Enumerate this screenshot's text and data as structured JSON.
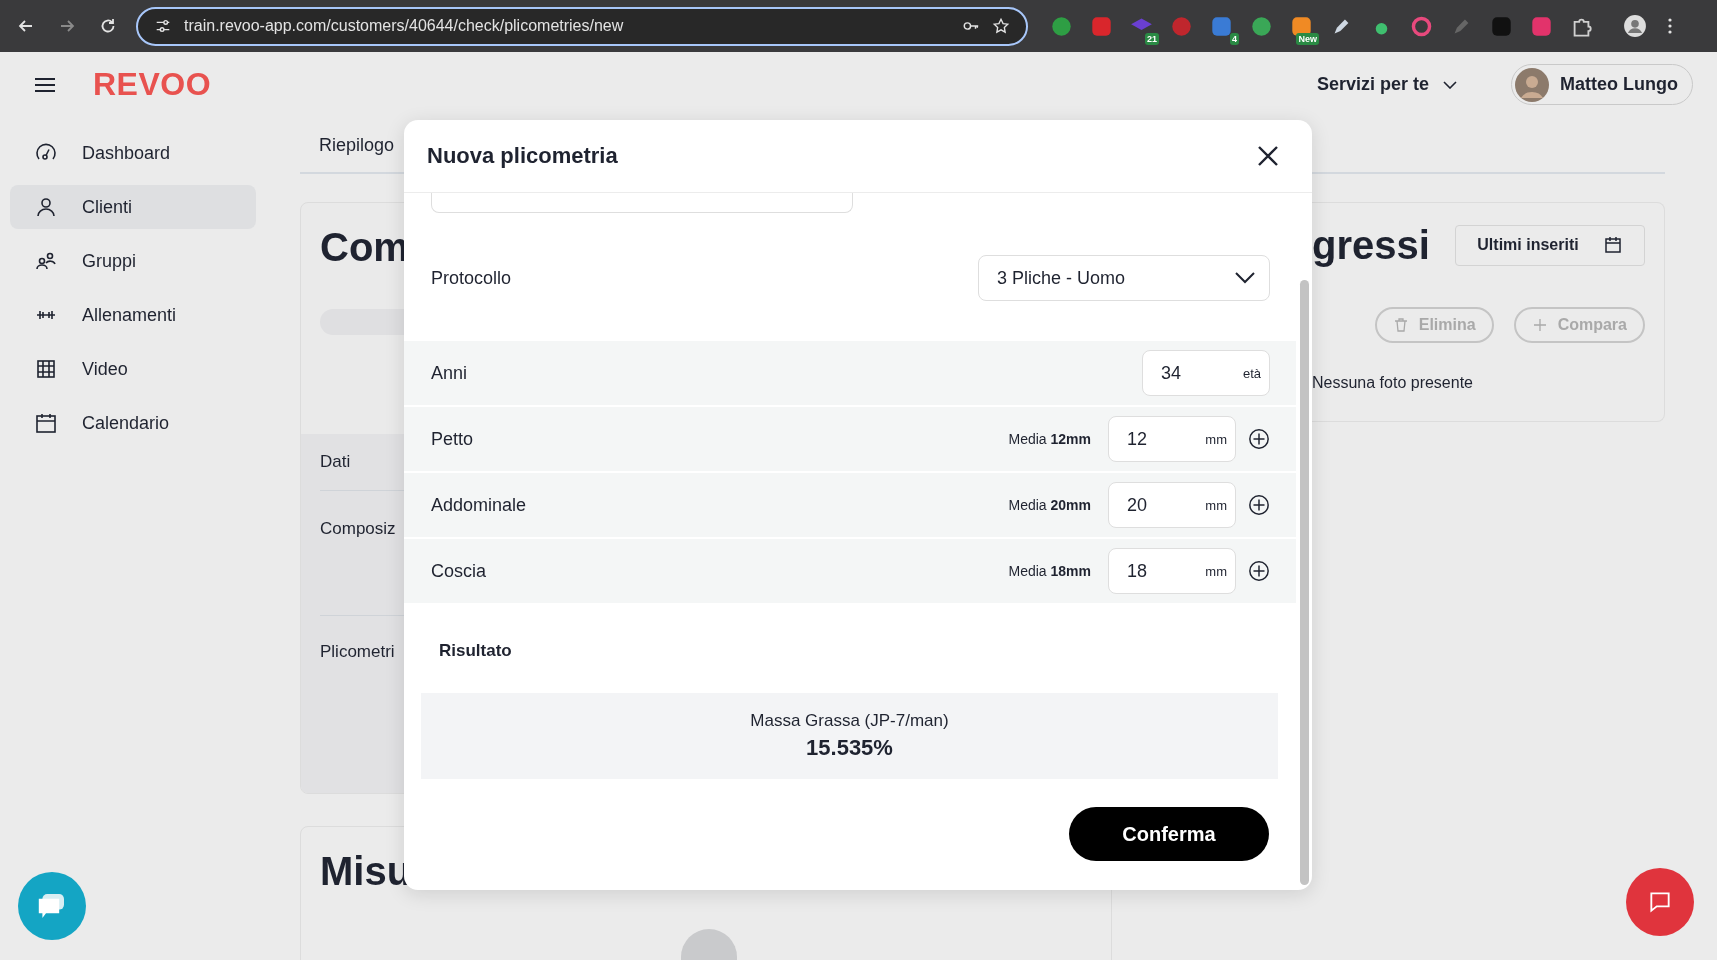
{
  "browser": {
    "url": "train.revoo-app.com/customers/40644/check/plicometries/new",
    "extension_badges": [
      "21",
      "4",
      "New"
    ]
  },
  "header": {
    "logo": "REVOO",
    "services_menu": "Servizi per te",
    "user_name": "Matteo Lungo"
  },
  "sidebar": {
    "items": [
      {
        "label": "Dashboard",
        "kind": "gauge",
        "selected": false
      },
      {
        "label": "Clienti",
        "kind": "person",
        "selected": true
      },
      {
        "label": "Gruppi",
        "kind": "group",
        "selected": false
      },
      {
        "label": "Allenamenti",
        "kind": "dumbbell",
        "selected": false
      },
      {
        "label": "Video",
        "kind": "film",
        "selected": false
      },
      {
        "label": "Calendario",
        "kind": "calendar",
        "selected": false
      }
    ]
  },
  "background": {
    "tab": "Riepilogo",
    "card_title": "Com",
    "section_header": "Dati",
    "rows": [
      "Composiz",
      "Plicometri"
    ],
    "second_card_title": "Misu",
    "progress_title": "gressi",
    "sort_button": "Ultimi inseriti",
    "delete_button": {
      "label": "Elimina",
      "disabled": true
    },
    "compare_button": {
      "label": "Compara",
      "disabled": true
    },
    "empty_photos": "Nessuna foto presente"
  },
  "modal": {
    "title": "Nuova plicometria",
    "protocol": {
      "label": "Protocollo",
      "value": "3 Pliche - Uomo"
    },
    "age": {
      "label": "Anni",
      "value": "34",
      "unit": "età"
    },
    "folds": [
      {
        "label": "Petto",
        "average": "Media **12mm**",
        "value": "12",
        "unit": "mm"
      },
      {
        "label": "Addominale",
        "average": "Media **20mm**",
        "value": "20",
        "unit": "mm"
      },
      {
        "label": "Coscia",
        "average": "Media **18mm**",
        "value": "18",
        "unit": "mm"
      }
    ],
    "result": {
      "heading": "Risultato",
      "label": "Massa Grassa (JP-7/man)",
      "value": "15.535%"
    },
    "confirm": "Conferma"
  }
}
